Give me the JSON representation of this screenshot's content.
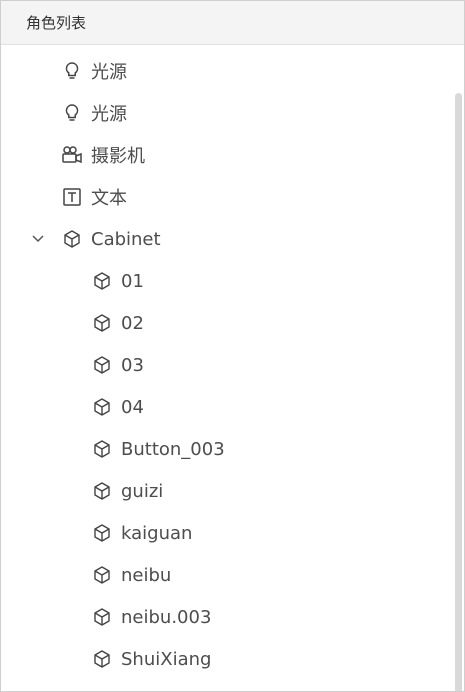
{
  "panel": {
    "title": "角色列表"
  },
  "tree": {
    "items": [
      {
        "label": "光源",
        "icon": "lightbulb-icon",
        "level": 0
      },
      {
        "label": "光源",
        "icon": "lightbulb-icon",
        "level": 0
      },
      {
        "label": "摄影机",
        "icon": "camera-icon",
        "level": 0
      },
      {
        "label": "文本",
        "icon": "text-icon",
        "level": 0
      },
      {
        "label": "Cabinet",
        "icon": "cube-icon",
        "level": 0,
        "expanded": true
      },
      {
        "label": "01",
        "icon": "cube-icon",
        "level": 1
      },
      {
        "label": "02",
        "icon": "cube-icon",
        "level": 1
      },
      {
        "label": "03",
        "icon": "cube-icon",
        "level": 1
      },
      {
        "label": "04",
        "icon": "cube-icon",
        "level": 1
      },
      {
        "label": "Button_003",
        "icon": "cube-icon",
        "level": 1
      },
      {
        "label": "guizi",
        "icon": "cube-icon",
        "level": 1
      },
      {
        "label": "kaiguan",
        "icon": "cube-icon",
        "level": 1
      },
      {
        "label": "neibu",
        "icon": "cube-icon",
        "level": 1
      },
      {
        "label": "neibu.003",
        "icon": "cube-icon",
        "level": 1
      },
      {
        "label": "ShuiXiang",
        "icon": "cube-icon",
        "level": 1
      }
    ]
  },
  "colors": {
    "header_bg": "#f4f4f4",
    "text": "#4d4d4d",
    "scrollbar": "#d9d9d9"
  }
}
